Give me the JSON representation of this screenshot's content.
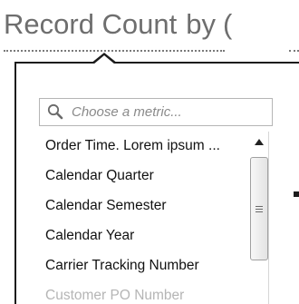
{
  "heading": {
    "metric": "Record Count",
    "connector": "by",
    "dimension_visible": "("
  },
  "search": {
    "placeholder": "Choose a metric..."
  },
  "list": {
    "items": [
      "Order Time. Lorem ipsum ...",
      "Calendar Quarter",
      "Calendar Semester",
      "Calendar Year",
      "Carrier Tracking Number",
      "Customer PO Number"
    ]
  },
  "icons": {
    "search": "search-icon",
    "scroll_up": "triangle-up-icon",
    "grip": "grip-lines-icon"
  },
  "colors": {
    "heading_text": "#6e6e6e",
    "popup_border": "#1c1c1c",
    "placeholder": "#8a8a8a",
    "item_text": "#111111",
    "faded_item_text": "#b5b5b5"
  }
}
